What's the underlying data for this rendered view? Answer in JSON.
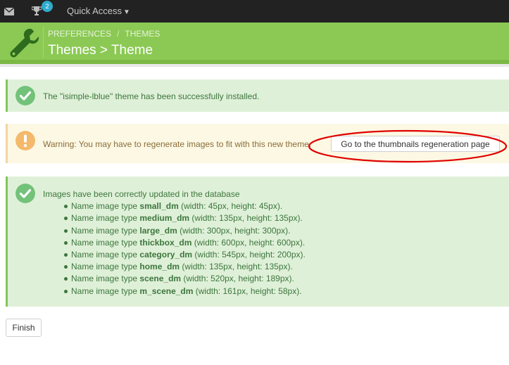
{
  "topbar": {
    "notifications_badge": "2",
    "quick_access_label": "Quick Access"
  },
  "header": {
    "breadcrumb": [
      "PREFERENCES",
      "THEMES"
    ],
    "title": "Themes > Theme"
  },
  "alerts": {
    "installed": "The \"isimple-lblue\" theme has been successfully installed.",
    "warning": "Warning: You may have to regenerate images to fit with this new theme.",
    "warning_button": "Go to the thumbnails regeneration page",
    "images_heading": "Images have been correctly updated in the database"
  },
  "image_types": [
    {
      "prefix": "Name image type ",
      "name": "small_dm",
      "suffix": " (width: 45px, height: 45px)."
    },
    {
      "prefix": "Name image type ",
      "name": "medium_dm",
      "suffix": " (width: 135px, height: 135px)."
    },
    {
      "prefix": "Name image type ",
      "name": "large_dm",
      "suffix": " (width: 300px, height: 300px)."
    },
    {
      "prefix": "Name image type ",
      "name": "thickbox_dm",
      "suffix": " (width: 600px, height: 600px)."
    },
    {
      "prefix": "Name image type ",
      "name": "category_dm",
      "suffix": " (width: 545px, height: 200px)."
    },
    {
      "prefix": "Name image type ",
      "name": "home_dm",
      "suffix": " (width: 135px, height: 135px)."
    },
    {
      "prefix": "Name image type ",
      "name": "scene_dm",
      "suffix": " (width: 520px, height: 189px)."
    },
    {
      "prefix": "Name image type ",
      "name": "m_scene_dm",
      "suffix": " (width: 161px, height: 58px)."
    }
  ],
  "finish_button": "Finish",
  "colors": {
    "header_green": "#8bc954",
    "success_bg": "#dff0d8",
    "warning_bg": "#fcf8e3",
    "annotation_red": "#e00000"
  }
}
